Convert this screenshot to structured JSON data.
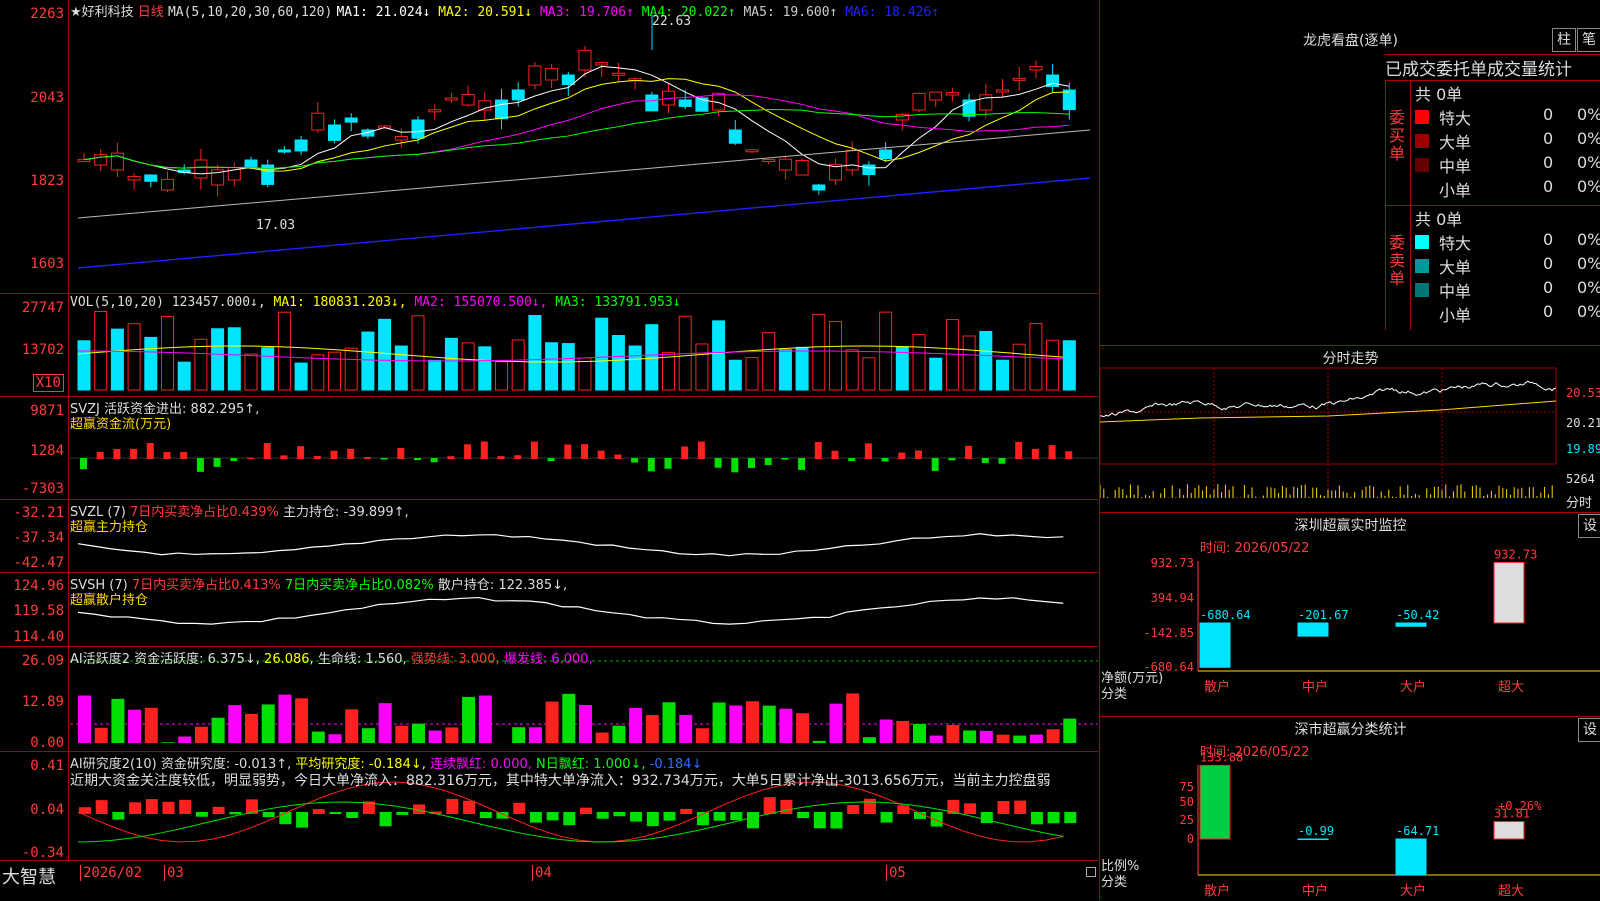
{
  "colors": {
    "up": "#ff2020",
    "down": "#00e5ff",
    "frame": "#aa0000"
  },
  "main": {
    "stock_name": "★好利科技",
    "period": "日线",
    "ma_params": "MA(5,10,20,30,60,120)",
    "ma": [
      {
        "label": "MA1: 21.024",
        "arrow": "↓",
        "color": "#ffffff"
      },
      {
        "label": "MA2: 20.591",
        "arrow": "↓",
        "color": "#ffff00"
      },
      {
        "label": "MA3: 19.706",
        "arrow": "↑",
        "color": "#ff00ff"
      },
      {
        "label": "MA4: 20.022",
        "arrow": "↑",
        "color": "#00ff00"
      },
      {
        "label": "MA5: 19.600",
        "arrow": "↑",
        "color": "#cccccc"
      },
      {
        "label": "MA6: 18.426",
        "arrow": "↑",
        "color": "#2020ff"
      }
    ],
    "axis": [
      "2263",
      "2043",
      "1823",
      "1603"
    ],
    "high_label": "22.63",
    "low_label": "17.03"
  },
  "vol": {
    "title": "VOL(5,10,20)",
    "value": "123457.000↓,",
    "ma1": "MA1: 180831.203↓,",
    "ma2": "MA2: 155070.500↓,",
    "ma3": "MA3: 133791.953↓",
    "axis": [
      "27747",
      "13702"
    ],
    "unit": "X10"
  },
  "svzj": {
    "title": "SVZJ",
    "text": "活跃资金进出: 882.295↑,",
    "sub": "超赢资金流(万元)",
    "axis": [
      "9871",
      "1284",
      "-7303"
    ]
  },
  "svzl": {
    "title": "SVZL (7)",
    "text1": "7日内买卖净占比0.439%",
    "text2": "主力持仓: -39.899↑,",
    "sub": "超赢主力持仓",
    "axis": [
      "-32.21",
      "-37.34",
      "-42.47"
    ]
  },
  "svsh": {
    "title": "SVSH (7)",
    "text1": "7日内买卖净占比0.413%",
    "text2": "7日内买卖净占比0.082%",
    "text3": "散户持仓: 122.385↓,",
    "sub": "超赢散户持仓",
    "axis": [
      "124.96",
      "119.58",
      "114.40"
    ]
  },
  "ai1": {
    "title": "AI活跃度2",
    "t1": "资金活跃度: 6.375↓,",
    "t2": "26.086,",
    "t3": "生命线: 1.560,",
    "t4": "强势线: 3.000,",
    "t5": "爆发线: 6.000,",
    "axis": [
      "26.09",
      "12.89",
      "0.00"
    ]
  },
  "ai2": {
    "title": "AI研究度2(10)",
    "t1": "资金研究度: -0.013↑,",
    "t2": "平均研究度: -0.184↓,",
    "t3": "连续飘红: 0.000,",
    "t4": "N日飘红: 1.000↓,",
    "t5": "-0.184↓",
    "comment": "近期大资金关注度较低，明显弱势，今日大单净流入：882.316万元，其中特大单净流入：932.734万元，大单5日累计净出-3013.656万元，当前主力控盘弱",
    "axis": [
      "0.41",
      "0.04",
      "-0.34"
    ]
  },
  "bottom": {
    "brand": "大智慧",
    "dates": [
      "2026/02",
      "03",
      "04",
      "05"
    ]
  },
  "longhu": {
    "title": "龙虎看盘(逐单)",
    "btn1": "柱",
    "btn2": "笔",
    "header": "已成交委托单成交量统计",
    "buy_side": "委买单",
    "sell_side": "委卖单",
    "buy_total": "共 0单",
    "sell_total": "共 0单",
    "buy_rows": [
      {
        "name": "特大",
        "val": "0",
        "pct": "0%",
        "color": "#ff0000"
      },
      {
        "name": "大单",
        "val": "0",
        "pct": "0%",
        "color": "#990000"
      },
      {
        "name": "中单",
        "val": "0",
        "pct": "0%",
        "color": "#660000"
      },
      {
        "name": "小单",
        "val": "0",
        "pct": "0%",
        "color": ""
      }
    ],
    "sell_rows": [
      {
        "name": "特大",
        "val": "0",
        "pct": "0%",
        "color": "#00ffff"
      },
      {
        "name": "大单",
        "val": "0",
        "pct": "0%",
        "color": "#009999"
      },
      {
        "name": "中单",
        "val": "0",
        "pct": "0%",
        "color": "#007777"
      },
      {
        "name": "小单",
        "val": "0",
        "pct": "0%",
        "color": ""
      }
    ]
  },
  "fenshi": {
    "title": "分时走势",
    "axis": [
      "20.53",
      "20.21",
      "19.89"
    ],
    "vol": "5264",
    "vol_label": "分时"
  },
  "sz_monitor": {
    "title": "深圳超赢实时监控",
    "btn": "设",
    "time": "时间: 2026/05/22",
    "axis": [
      "932.73",
      "394.94",
      "-142.85",
      "-680.64"
    ],
    "ylabel": "净额(万元)",
    "xlabel": "分类",
    "categories": [
      "散户",
      "中户",
      "大户",
      "超大"
    ],
    "values": [
      -680.64,
      -201.67,
      -50.42,
      932.73
    ],
    "labels": [
      "-680.64",
      "-201.67",
      "-50.42",
      "932.73"
    ]
  },
  "sz_class": {
    "title": "深市超赢分类统计",
    "btn": "设",
    "time": "时间: 2026/05/22",
    "axis": [
      "75",
      "50",
      "25",
      "0"
    ],
    "ylabel": "比例%",
    "xlabel": "分类",
    "categories": [
      "散户",
      "中户",
      "大户",
      "超大"
    ],
    "values": [
      133.88,
      -0.99,
      -64.71,
      31.81
    ],
    "labels": [
      "133.88",
      "-0.99",
      "-64.71",
      "31.81"
    ],
    "pct_label": "+0.26%"
  }
}
